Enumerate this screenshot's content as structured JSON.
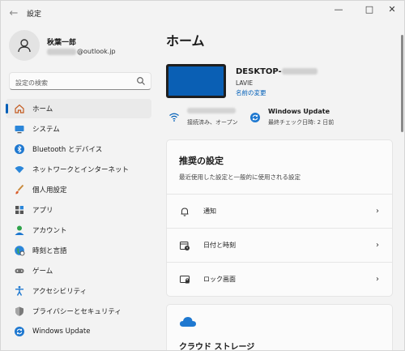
{
  "window": {
    "title": "設定"
  },
  "profile": {
    "name": "秋葉一郎",
    "email_domain": "@outlook.jp"
  },
  "search": {
    "placeholder": "設定の検索"
  },
  "sidebar": {
    "items": [
      {
        "label": "ホーム",
        "icon": "home-icon",
        "active": true
      },
      {
        "label": "システム",
        "icon": "monitor-icon"
      },
      {
        "label": "Bluetooth とデバイス",
        "icon": "bluetooth-icon"
      },
      {
        "label": "ネットワークとインターネット",
        "icon": "wifi-icon"
      },
      {
        "label": "個人用設定",
        "icon": "brush-icon"
      },
      {
        "label": "アプリ",
        "icon": "apps-icon"
      },
      {
        "label": "アカウント",
        "icon": "account-icon"
      },
      {
        "label": "時刻と言語",
        "icon": "globe-icon"
      },
      {
        "label": "ゲーム",
        "icon": "gamepad-icon"
      },
      {
        "label": "アクセシビリティ",
        "icon": "accessibility-icon"
      },
      {
        "label": "プライバシーとセキュリティ",
        "icon": "shield-icon"
      },
      {
        "label": "Windows Update",
        "icon": "update-icon"
      }
    ]
  },
  "main": {
    "title": "ホーム",
    "device": {
      "name_prefix": "DESKTOP-",
      "model": "LAVIE",
      "rename_link": "名前の変更"
    },
    "network": {
      "status": "接続済み、オープン"
    },
    "windows_update": {
      "title": "Windows Update",
      "last_check": "最終チェック日時: 2 日前"
    },
    "recommended": {
      "title": "推奨の設定",
      "description": "最近使用した設定と一般的に使用される設定",
      "items": [
        {
          "label": "通知",
          "icon": "bell-icon"
        },
        {
          "label": "日付と時刻",
          "icon": "calendar-clock-icon"
        },
        {
          "label": "ロック画面",
          "icon": "lock-screen-icon"
        }
      ]
    },
    "cloud": {
      "title": "クラウド ストレージ"
    }
  },
  "colors": {
    "accent": "#005fb8",
    "device_thumb": "#0a5fb4"
  }
}
